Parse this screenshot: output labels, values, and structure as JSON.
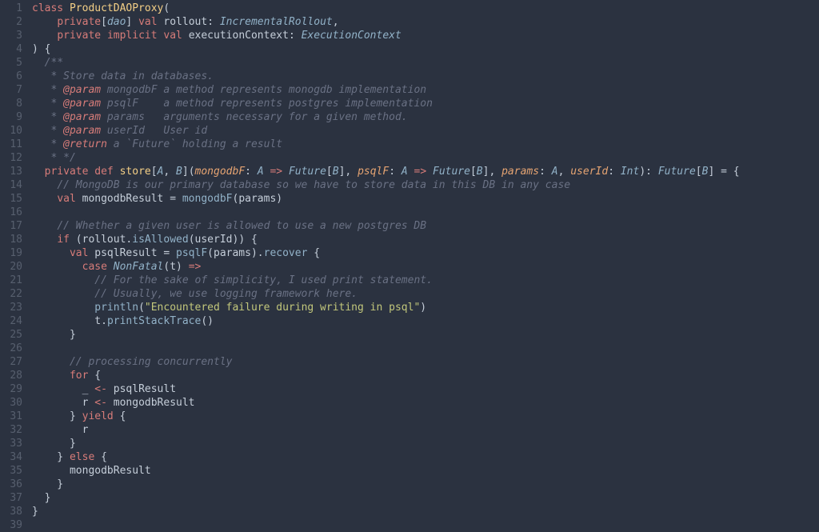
{
  "line_count": 39,
  "tokens": [
    [
      [
        "class ",
        "kw"
      ],
      [
        "ProductDAOProxy",
        "def"
      ],
      [
        "(",
        "punct"
      ]
    ],
    [
      [
        "    ",
        ""
      ],
      [
        "private",
        "kw"
      ],
      [
        "[",
        "punct"
      ],
      [
        "dao",
        "type"
      ],
      [
        "] ",
        "punct"
      ],
      [
        "val ",
        "kw"
      ],
      [
        "rollout",
        "ident"
      ],
      [
        ": ",
        "punct"
      ],
      [
        "IncrementalRollout",
        "type"
      ],
      [
        ",",
        "punct"
      ]
    ],
    [
      [
        "    ",
        ""
      ],
      [
        "private ",
        "kw"
      ],
      [
        "implicit ",
        "kw"
      ],
      [
        "val ",
        "kw"
      ],
      [
        "executionContext",
        "ident"
      ],
      [
        ": ",
        "punct"
      ],
      [
        "ExecutionContext",
        "type"
      ]
    ],
    [
      [
        ") {",
        "punct"
      ]
    ],
    [
      [
        "  ",
        ""
      ],
      [
        "/**",
        "cmt"
      ]
    ],
    [
      [
        "   * Store data in databases.",
        "cmt"
      ]
    ],
    [
      [
        "   * ",
        "cmt"
      ],
      [
        "@param",
        "doc-kw"
      ],
      [
        " mongodbF a method represents monogdb implementation",
        "cmt"
      ]
    ],
    [
      [
        "   * ",
        "cmt"
      ],
      [
        "@param",
        "doc-kw"
      ],
      [
        " psqlF    a method represents postgres implementation",
        "cmt"
      ]
    ],
    [
      [
        "   * ",
        "cmt"
      ],
      [
        "@param",
        "doc-kw"
      ],
      [
        " params   arguments necessary for a given method.",
        "cmt"
      ]
    ],
    [
      [
        "   * ",
        "cmt"
      ],
      [
        "@param",
        "doc-kw"
      ],
      [
        " userId   User id",
        "cmt"
      ]
    ],
    [
      [
        "   * ",
        "cmt"
      ],
      [
        "@return",
        "doc-kw"
      ],
      [
        " a `Future` holding a result",
        "cmt"
      ]
    ],
    [
      [
        "   * */",
        "cmt"
      ]
    ],
    [
      [
        "  ",
        ""
      ],
      [
        "private ",
        "kw"
      ],
      [
        "def ",
        "kw"
      ],
      [
        "store",
        "def"
      ],
      [
        "[",
        "punct"
      ],
      [
        "A",
        "type"
      ],
      [
        ", ",
        "punct"
      ],
      [
        "B",
        "type"
      ],
      [
        "](",
        "punct"
      ],
      [
        "mongodbF",
        "param"
      ],
      [
        ": ",
        "punct"
      ],
      [
        "A",
        "type"
      ],
      [
        " => ",
        "kw"
      ],
      [
        "Future",
        "type"
      ],
      [
        "[",
        "punct"
      ],
      [
        "B",
        "type"
      ],
      [
        "], ",
        "punct"
      ],
      [
        "psqlF",
        "param"
      ],
      [
        ": ",
        "punct"
      ],
      [
        "A",
        "type"
      ],
      [
        " => ",
        "kw"
      ],
      [
        "Future",
        "type"
      ],
      [
        "[",
        "punct"
      ],
      [
        "B",
        "type"
      ],
      [
        "], ",
        "punct"
      ],
      [
        "params",
        "param"
      ],
      [
        ": ",
        "punct"
      ],
      [
        "A",
        "type"
      ],
      [
        ", ",
        "punct"
      ],
      [
        "userId",
        "param"
      ],
      [
        ": ",
        "punct"
      ],
      [
        "Int",
        "type"
      ],
      [
        "): ",
        "punct"
      ],
      [
        "Future",
        "type"
      ],
      [
        "[",
        "punct"
      ],
      [
        "B",
        "type"
      ],
      [
        "] = {",
        "punct"
      ]
    ],
    [
      [
        "    ",
        ""
      ],
      [
        "// MongoDB is our primary database so we have to store data in this DB in any case",
        "cmt"
      ]
    ],
    [
      [
        "    ",
        ""
      ],
      [
        "val ",
        "kw"
      ],
      [
        "mongodbResult ",
        "ident"
      ],
      [
        "= ",
        "punct"
      ],
      [
        "mongodbF",
        "fn"
      ],
      [
        "(",
        "punct"
      ],
      [
        "params",
        "ident"
      ],
      [
        ")",
        "punct"
      ]
    ],
    [
      [
        "",
        ""
      ]
    ],
    [
      [
        "    ",
        ""
      ],
      [
        "// Whether a given user is allowed to use a new postgres DB",
        "cmt"
      ]
    ],
    [
      [
        "    ",
        ""
      ],
      [
        "if ",
        "kw"
      ],
      [
        "(",
        "punct"
      ],
      [
        "rollout",
        "ident"
      ],
      [
        ".",
        "punct"
      ],
      [
        "isAllowed",
        "fn"
      ],
      [
        "(",
        "punct"
      ],
      [
        "userId",
        "ident"
      ],
      [
        ")) {",
        "punct"
      ]
    ],
    [
      [
        "      ",
        ""
      ],
      [
        "val ",
        "kw"
      ],
      [
        "psqlResult ",
        "ident"
      ],
      [
        "= ",
        "punct"
      ],
      [
        "psqlF",
        "fn"
      ],
      [
        "(",
        "punct"
      ],
      [
        "params",
        "ident"
      ],
      [
        ").",
        "punct"
      ],
      [
        "recover ",
        "fn"
      ],
      [
        "{",
        "punct"
      ]
    ],
    [
      [
        "        ",
        ""
      ],
      [
        "case ",
        "kw"
      ],
      [
        "NonFatal",
        "type"
      ],
      [
        "(",
        "punct"
      ],
      [
        "t",
        "ident"
      ],
      [
        ") ",
        "punct"
      ],
      [
        "=>",
        "kw"
      ]
    ],
    [
      [
        "          ",
        ""
      ],
      [
        "// For the sake of simplicity, I used print statement.",
        "cmt"
      ]
    ],
    [
      [
        "          ",
        ""
      ],
      [
        "// Usually, we use logging framework here.",
        "cmt"
      ]
    ],
    [
      [
        "          ",
        ""
      ],
      [
        "println",
        "fn"
      ],
      [
        "(",
        "punct"
      ],
      [
        "\"Encountered failure during writing in psql\"",
        "str"
      ],
      [
        ")",
        "punct"
      ]
    ],
    [
      [
        "          ",
        ""
      ],
      [
        "t",
        "ident"
      ],
      [
        ".",
        "punct"
      ],
      [
        "printStackTrace",
        "fn"
      ],
      [
        "()",
        "punct"
      ]
    ],
    [
      [
        "      }",
        "punct"
      ]
    ],
    [
      [
        "",
        ""
      ]
    ],
    [
      [
        "      ",
        ""
      ],
      [
        "// processing concurrently",
        "cmt"
      ]
    ],
    [
      [
        "      ",
        ""
      ],
      [
        "for ",
        "kw"
      ],
      [
        "{",
        "punct"
      ]
    ],
    [
      [
        "        _ ",
        "ident"
      ],
      [
        "<- ",
        "kw"
      ],
      [
        "psqlResult",
        "ident"
      ]
    ],
    [
      [
        "        r ",
        "ident"
      ],
      [
        "<- ",
        "kw"
      ],
      [
        "mongodbResult",
        "ident"
      ]
    ],
    [
      [
        "      } ",
        "punct"
      ],
      [
        "yield ",
        "kw"
      ],
      [
        "{",
        "punct"
      ]
    ],
    [
      [
        "        r",
        "ident"
      ]
    ],
    [
      [
        "      }",
        "punct"
      ]
    ],
    [
      [
        "    } ",
        "punct"
      ],
      [
        "else ",
        "kw"
      ],
      [
        "{",
        "punct"
      ]
    ],
    [
      [
        "      mongodbResult",
        "ident"
      ]
    ],
    [
      [
        "    }",
        "punct"
      ]
    ],
    [
      [
        "  }",
        "punct"
      ]
    ],
    [
      [
        "}",
        "punct"
      ]
    ],
    [
      [
        "",
        ""
      ]
    ]
  ]
}
